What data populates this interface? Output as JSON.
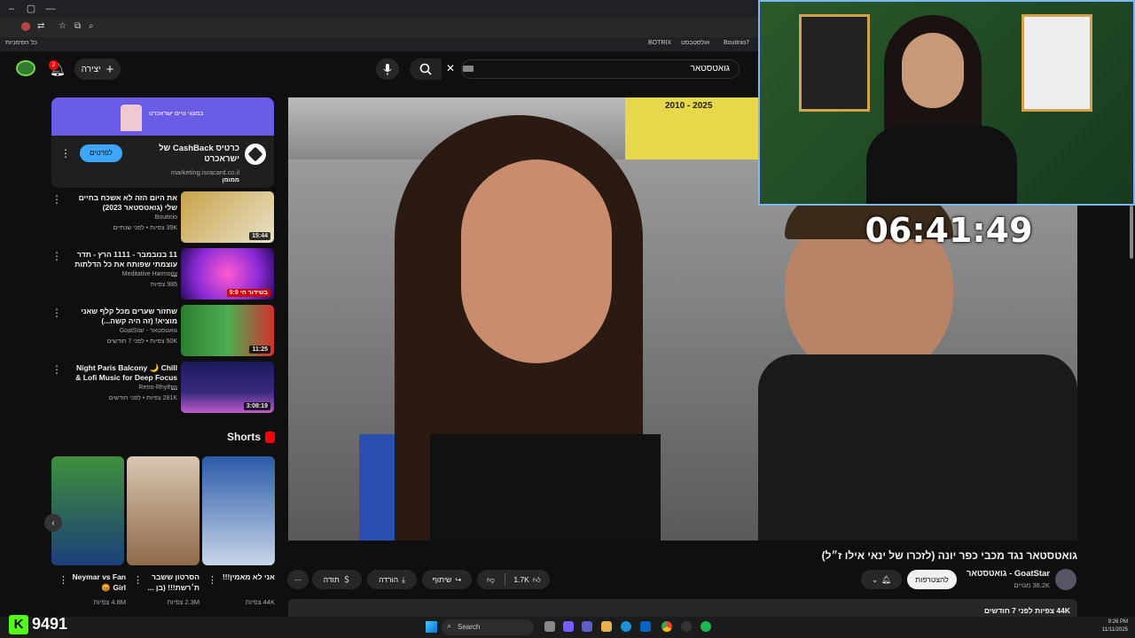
{
  "browser": {
    "bookmarks": [
      "כל הסימניות",
      "BOTRIX",
      "אולסטבסט",
      "Boutinio7"
    ]
  },
  "header": {
    "search_query": "גואטסטאר",
    "create_label": "יצירה",
    "notification_count": "2"
  },
  "ad": {
    "banner_text": "במצגי טיים ישראכרט",
    "title": "כרטיס CashBack של ישראכרט",
    "domain": "marketing.isracard.co.il",
    "sponsored": "ממומן",
    "cta": "לפרטים"
  },
  "recommendations": [
    {
      "title": "את היום הזה לא אשכח בחיים שלי (גואטסטאר 2023)",
      "channel": "Boutinio",
      "meta": "39K צפיות • לפני שנתיים",
      "duration": "15:44",
      "colors": [
        "#c9a24a",
        "#e8e2c8"
      ]
    },
    {
      "title": "11 בנובמבר - 1111 הרץ - תדר עוצמתי שפותח את כל הדלתות ...",
      "channel": "Meditative Harmony",
      "meta": "985 צפיות",
      "duration": "9:9 בשידור חי",
      "colors": [
        "#8a2bd6",
        "#ff5ad1"
      ]
    },
    {
      "title": "שחזור שערים מכל קלף שאני מוציא! (זה היה קשה...)",
      "channel": "גואטסטאר - GoatStar",
      "meta": "50K צפיות • לפני 7 חודשים",
      "duration": "11:25",
      "colors": [
        "#2e7d32",
        "#d32f2f"
      ]
    },
    {
      "title": "Night Paris Balcony 🌙 Chill Lofi Music for Deep Focus & ...",
      "channel": "Retro-Rhythm",
      "meta": "281K צפיות • לפני חודשים",
      "duration": "3:08:19",
      "colors": [
        "#1a1a5e",
        "#c05ad0"
      ]
    }
  ],
  "shorts": {
    "heading": "Shorts",
    "items": [
      {
        "title": "Neymar vs Fan Girl 😡",
        "views": "4.8M צפיות",
        "colors": [
          "#3f8f3a",
          "#1c3f7a"
        ]
      },
      {
        "title": "הסרטון ששבר ת׳רשת!!! (בן ...",
        "views": "2.3M צפיות",
        "colors": [
          "#d8c6b0",
          "#8f6a4a"
        ]
      },
      {
        "title": "אני לא מאמין!!!",
        "views": "44K צפיות",
        "colors": [
          "#2a5aa8",
          "#c8d6e8"
        ]
      }
    ]
  },
  "video": {
    "title": "גואטסטאר נגד מכבי כפר יונה (לזכרו של ינאי אילו ז״ל)",
    "channel": "GoatStar - גואטסטאר",
    "subscribers": "36.2K מנויים",
    "subscribe_label": "להצטרפות",
    "likes": "1.7K",
    "share_label": "שיתוף",
    "download_label": "הורדה",
    "thanks_label": "תודה",
    "views_and_date": "44K צפיות  לפני 7 חודשים",
    "scoreboard": "2010 - 2025"
  },
  "overlay": {
    "timer": "06:41:49",
    "kick_count": "9491"
  },
  "taskbar": {
    "search_label": "Search",
    "time": "9:26 PM",
    "date": "11/11/2025"
  }
}
